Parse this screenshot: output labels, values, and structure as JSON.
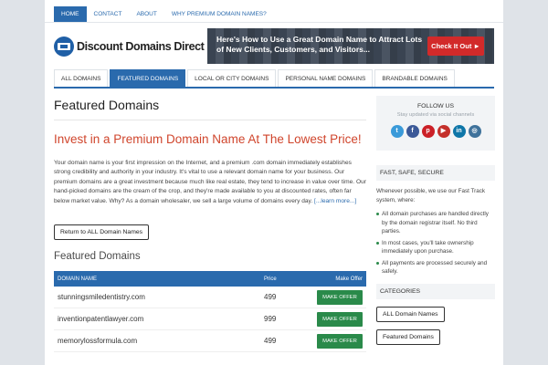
{
  "top_nav": [
    "HOME",
    "CONTACT",
    "ABOUT",
    "WHY PREMIUM DOMAIN NAMES?"
  ],
  "logo_text": "Discount Domains Direct",
  "banner": {
    "text": "Here's How to Use a Great Domain Name to Attract Lots of New Clients, Customers, and Visitors...",
    "button": "Check It Out ►"
  },
  "main_nav": [
    "ALL DOMAINS",
    "FEATURED DOMAINS",
    "LOCAL OR CITY DOMAINS",
    "PERSONAL NAME DOMAINS",
    "BRANDABLE DOMAINS"
  ],
  "content": {
    "page_title": "Featured Domains",
    "headline": "Invest in a Premium Domain Name At The Lowest Price!",
    "body": "Your domain name is your first impression on the Internet, and a premium .com domain immediately establishes strong credibility and authority in your industry. It's vital to use a relevant domain name for your business. Our premium domains are a great investment because much like real estate, they tend to increase in value over time. Our hand-picked domains are the cream of the crop, and they're made available to you at discounted rates, often far below market value. Why? As a domain wholesaler, we sell a large volume of domains every day.",
    "learn_more": "[...learn more...]",
    "return_button": "Return to ALL Domain Names",
    "section_title": "Featured Domains"
  },
  "table": {
    "headers": [
      "DOMAIN NAME",
      "Price",
      "Make Offer"
    ],
    "rows": [
      {
        "domain": "stunningsmiledentistry.com",
        "price": "499",
        "action": "MAKE OFFER"
      },
      {
        "domain": "inventionpatentlawyer.com",
        "price": "999",
        "action": "MAKE OFFER"
      },
      {
        "domain": "memorylossformula.com",
        "price": "499",
        "action": "MAKE OFFER"
      }
    ]
  },
  "sidebar": {
    "follow_title": "FOLLOW US",
    "follow_sub": "Stay updated via social channels",
    "social": [
      {
        "icon": "twitter-icon",
        "glyph": "t",
        "color": "#3a9ad9"
      },
      {
        "icon": "facebook-icon",
        "glyph": "f",
        "color": "#3b5998"
      },
      {
        "icon": "pinterest-icon",
        "glyph": "p",
        "color": "#cb2027"
      },
      {
        "icon": "youtube-icon",
        "glyph": "▶",
        "color": "#c4302b"
      },
      {
        "icon": "linkedin-icon",
        "glyph": "in",
        "color": "#0e76a8"
      },
      {
        "icon": "instagram-icon",
        "glyph": "◎",
        "color": "#3f729b"
      }
    ],
    "fast_title": "FAST, SAFE, SECURE",
    "fast_text": "Whenever possible, we use our Fast Track system, where:",
    "fast_list": [
      "All domain purchases are handled directly by the domain registrar itself. No third parties.",
      "In most cases, you'll take ownership immediately upon purchase.",
      "All payments are processed securely and safely."
    ],
    "categories_title": "CATEGORIES",
    "categories": [
      "ALL Domain Names",
      "Featured Domains"
    ]
  }
}
